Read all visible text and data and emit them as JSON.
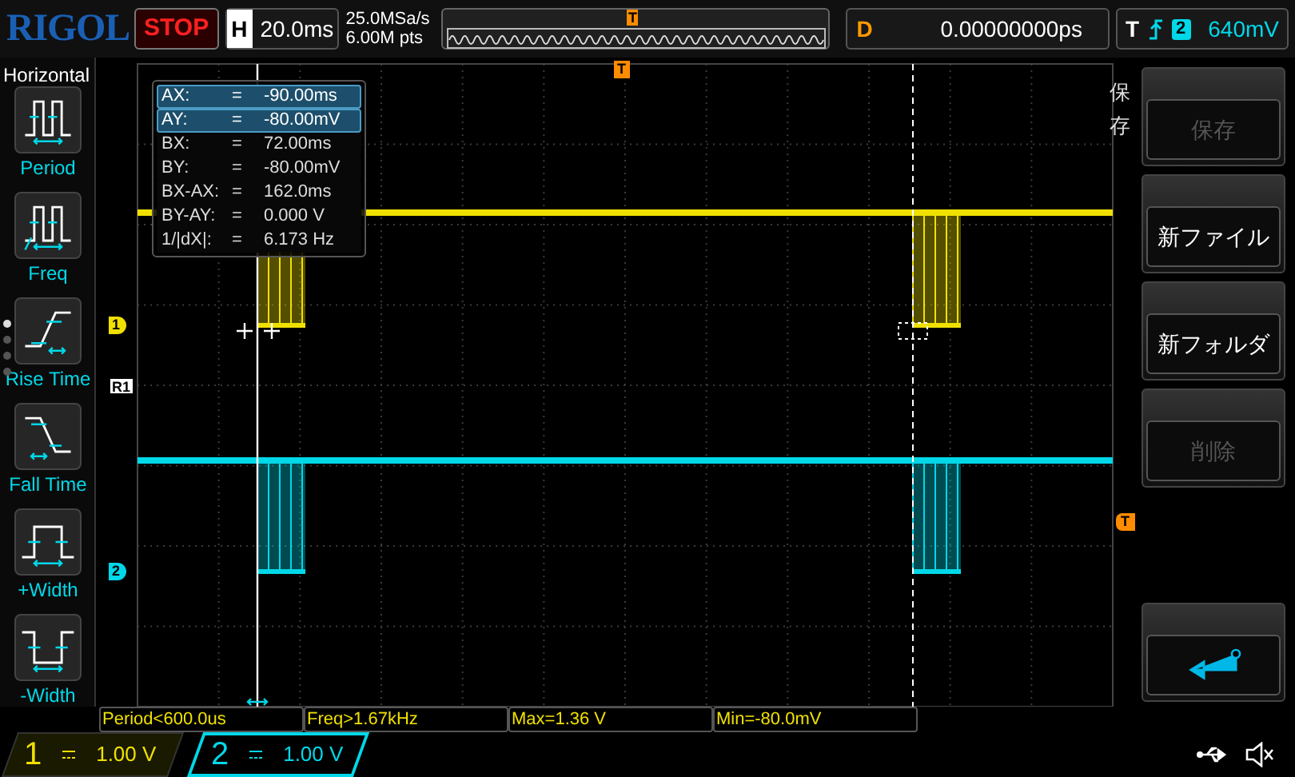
{
  "header": {
    "logo": "RIGOL",
    "run_state": "STOP",
    "horizontal": {
      "label": "H",
      "value": "20.0ms"
    },
    "sample_rate": "25.0MSa/s",
    "memory_depth": "6.00M pts",
    "overview_marker": "T",
    "delay": {
      "label": "D",
      "value": "0.00000000ps"
    },
    "trigger": {
      "label": "T",
      "source": "2",
      "level": "640mV"
    }
  },
  "left_menu": {
    "title": "Horizontal",
    "items": [
      {
        "kind": "period",
        "label": "Period"
      },
      {
        "kind": "freq",
        "label": "Freq"
      },
      {
        "kind": "rise",
        "label": "Rise Time"
      },
      {
        "kind": "fall",
        "label": "Fall Time"
      },
      {
        "kind": "pwidth",
        "label": "+Width"
      },
      {
        "kind": "nwidth",
        "label": "-Width"
      }
    ],
    "pages": [
      {
        "selected": true
      },
      {
        "selected": false
      },
      {
        "selected": false
      },
      {
        "selected": false
      }
    ]
  },
  "cursor_readout": [
    {
      "label": "AX:",
      "eq": "=",
      "value": "-90.00ms",
      "selected": true
    },
    {
      "label": "AY:",
      "eq": "=",
      "value": "-80.00mV",
      "selected": true
    },
    {
      "label": "BX:",
      "eq": "=",
      "value": "72.00ms",
      "selected": false
    },
    {
      "label": "BY:",
      "eq": "=",
      "value": "-80.00mV",
      "selected": false
    },
    {
      "label": "BX-AX:",
      "eq": "=",
      "value": "162.0ms",
      "selected": false
    },
    {
      "label": "BY-AY:",
      "eq": "=",
      "value": "0.000 V",
      "selected": false
    },
    {
      "label": "1/|dX|:",
      "eq": "=",
      "value": "6.173 Hz",
      "selected": false
    }
  ],
  "markers": [
    {
      "kind": "channel",
      "label": "1",
      "color": "#f0e000"
    },
    {
      "kind": "ref",
      "label": "R1",
      "color": "#ffffff"
    },
    {
      "kind": "channel",
      "label": "2",
      "color": "#00d8e8"
    }
  ],
  "trigger_position_marker": "T",
  "trigger_level_marker": "T",
  "measurements": [
    "Period<600.0us",
    "Freq>1.67kHz",
    "Max=1.36 V",
    "Min=-80.0mV"
  ],
  "channels": [
    {
      "number": "1",
      "scale": "1.00 V",
      "color": "#f0e000",
      "selected": false
    },
    {
      "number": "2",
      "scale": "1.00 V",
      "color": "#00d8e8",
      "selected": true
    }
  ],
  "right_menu": {
    "title": "保存",
    "buttons": [
      {
        "kind": "text",
        "label": "保存",
        "disabled": true
      },
      {
        "kind": "text",
        "label": "新ファイル",
        "disabled": false
      },
      {
        "kind": "text",
        "label": "新フォルダ",
        "disabled": false
      },
      {
        "kind": "text",
        "label": "削除",
        "disabled": true
      },
      {
        "kind": "gap"
      },
      {
        "kind": "enter",
        "disabled": false
      }
    ]
  }
}
